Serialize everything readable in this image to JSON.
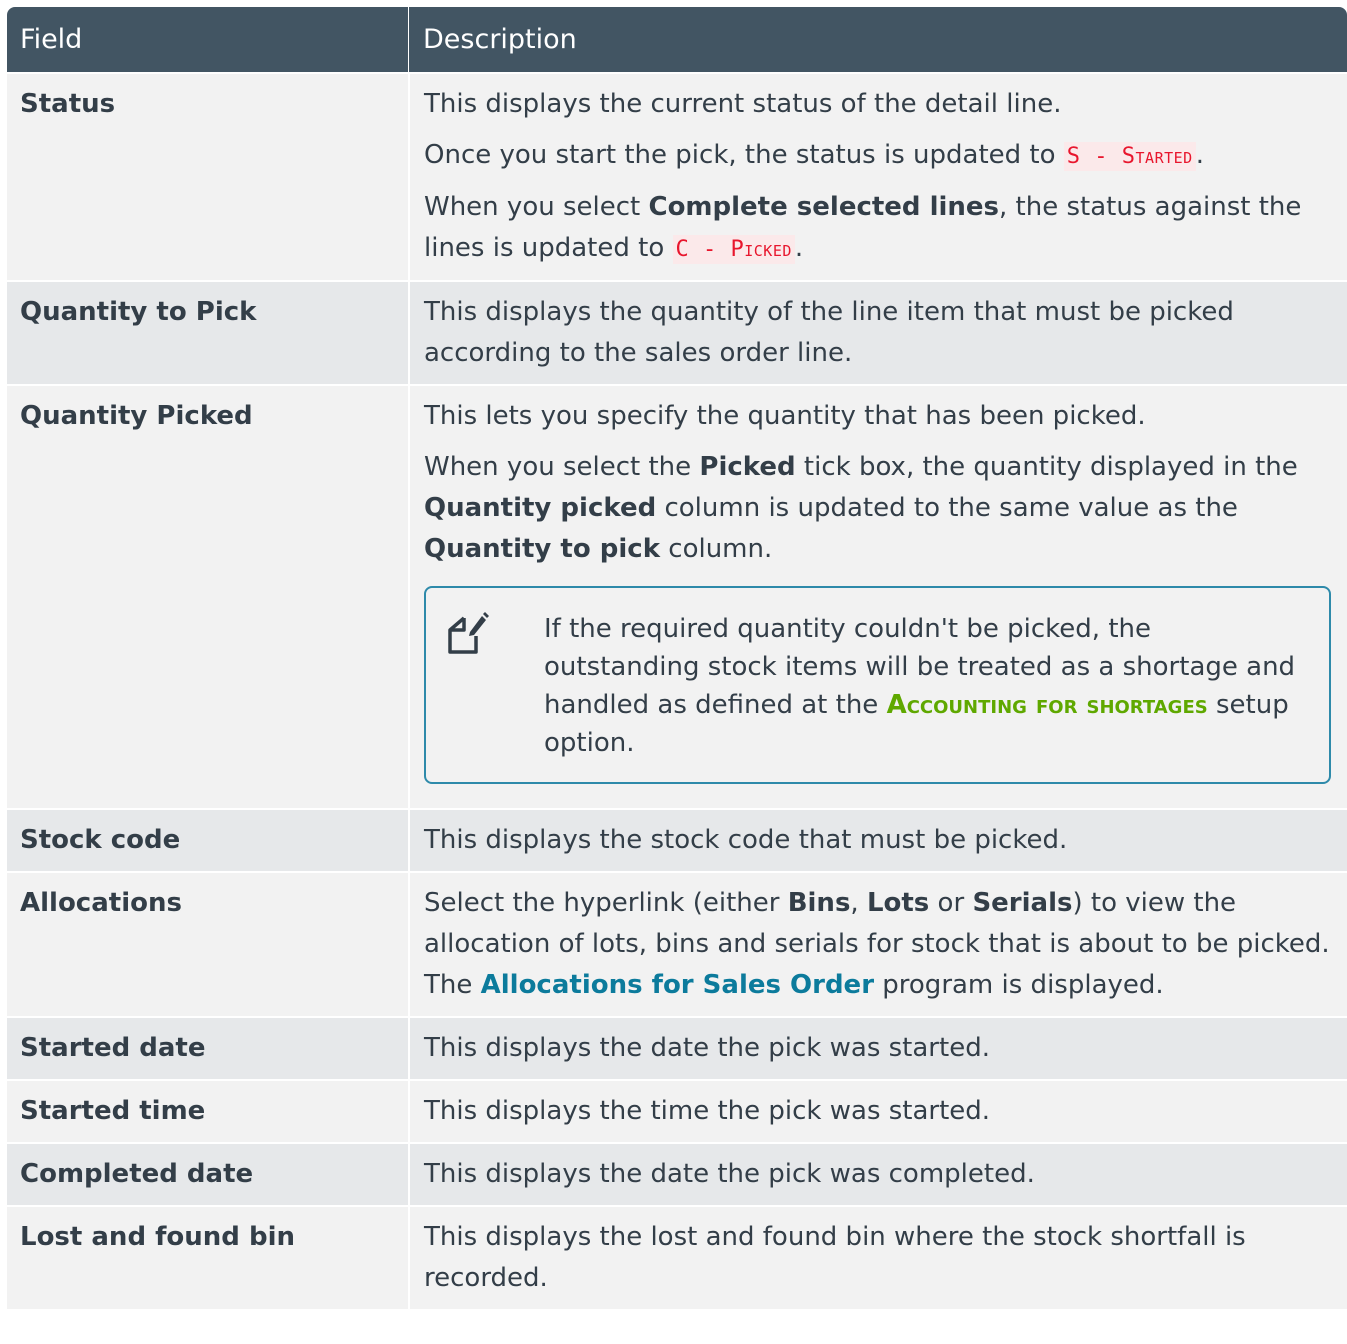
{
  "header": {
    "field": "Field",
    "description": "Description"
  },
  "rows": [
    {
      "field": "Status",
      "lines": {
        "l1": "This displays the current status of the detail line.",
        "l2a": "Once you start the pick, the status is updated to ",
        "l2code_a": "S - ",
        "l2code_b": "Started",
        "l2b": ".",
        "l3a": "When you select ",
        "l3bold": "Complete selected lines",
        "l3b": ", the status against the lines is updated to ",
        "l3code_a": "C - ",
        "l3code_b": "Picked",
        "l3c": "."
      }
    },
    {
      "field": "Quantity to Pick",
      "desc": "This displays the quantity of the line item that must be picked according to the sales order line."
    },
    {
      "field": "Quantity Picked",
      "lines": {
        "l1": "This lets you specify the quantity that has been picked.",
        "l2a": "When you select the ",
        "l2b1": "Picked",
        "l2c": " tick box, the quantity displayed in the ",
        "l2b2": "Quantity picked",
        "l2d": " column is updated to the same value as the ",
        "l2b3": "Quantity to pick",
        "l2e": " column."
      },
      "note": {
        "icon": "edit-note-icon",
        "text_a": "If the required quantity couldn't be picked, the outstanding stock items will be treated as a shortage and handled as defined at the ",
        "link": "Accounting for shortages",
        "text_b": " setup option."
      }
    },
    {
      "field": "Stock code",
      "desc": "This displays the stock code that must be picked."
    },
    {
      "field": "Allocations",
      "lines": {
        "a": "Select the hyperlink (either ",
        "b1": "Bins",
        "c": ", ",
        "b2": "Lots",
        "d": " or ",
        "b3": "Serials",
        "e": ") to view the allocation of lots, bins and serials for stock that is about to be picked. The ",
        "link": "Allocations for Sales Order",
        "f": " program is displayed."
      }
    },
    {
      "field": "Started date",
      "desc": "This displays the date the pick was started."
    },
    {
      "field": "Started time",
      "desc": "This displays the time the pick was started."
    },
    {
      "field": "Completed date",
      "desc": "This displays the date the pick was completed."
    },
    {
      "field": "Lost and found bin",
      "desc": "This displays the lost and found bin where the stock shortfall is recorded."
    }
  ],
  "colors": {
    "header_bg": "#425563",
    "row_light": "#f2f2f2",
    "row_dark": "#e6e8ea",
    "code_red": "#e8162d",
    "link_blue": "#0c7b9c",
    "link_green": "#5fa800",
    "note_border": "#2e8aaa"
  }
}
